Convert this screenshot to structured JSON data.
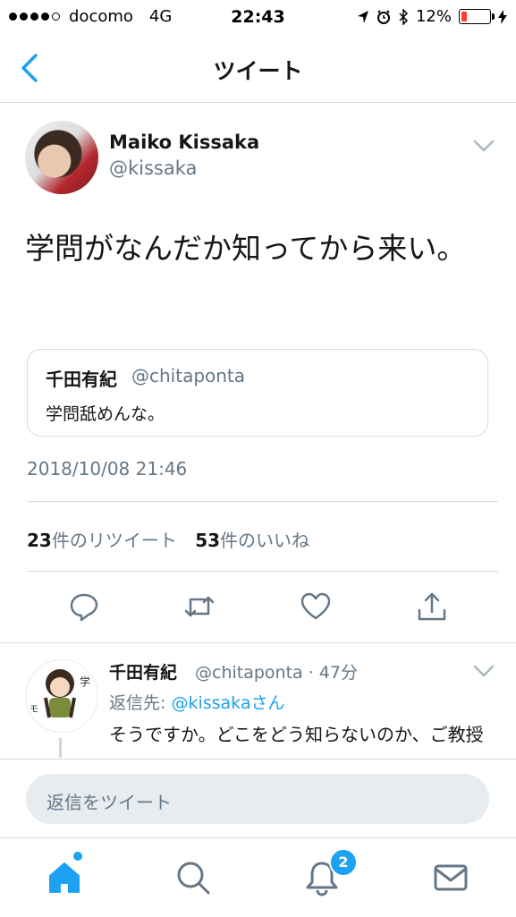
{
  "status_bar": {
    "carrier": "docomo",
    "network": "4G",
    "time": "22:43",
    "battery": "12%",
    "battery_level_percent": 12
  },
  "nav": {
    "title": "ツイート",
    "back_icon": "chevron-left-icon"
  },
  "tweet": {
    "author_name": "Maiko Kissaka",
    "author_handle": "@kissaka",
    "text": "学問がなんだか知ってから来い。",
    "quoted": {
      "name": "千田有紀",
      "handle": "@chitaponta",
      "text": "学問舐めんな。"
    },
    "timestamp": "2018/10/08 21:46",
    "retweet_count": "23",
    "retweet_label": "件のリツイート",
    "like_count": "53",
    "like_label": "件のいいね"
  },
  "actions": [
    "reply-icon",
    "retweet-icon",
    "like-icon",
    "share-icon"
  ],
  "reply": {
    "name": "千田有紀",
    "handle_time": "@chitaponta · 47分",
    "to_prefix": "返信先: ",
    "to_mention": "@kissaka",
    "to_suffix": "さん",
    "text": "そうですか。どこをどう知らないのか、ご教授いただけますか？"
  },
  "reply_box": {
    "placeholder": "返信をツイート"
  },
  "tab_bar": {
    "tabs": [
      "home-icon",
      "search-icon",
      "notifications-icon",
      "messages-icon"
    ],
    "notification_badge": "2"
  },
  "colors": {
    "accent": "#1da1f2",
    "secondary_text": "#657786",
    "border": "#d6dbe0"
  }
}
